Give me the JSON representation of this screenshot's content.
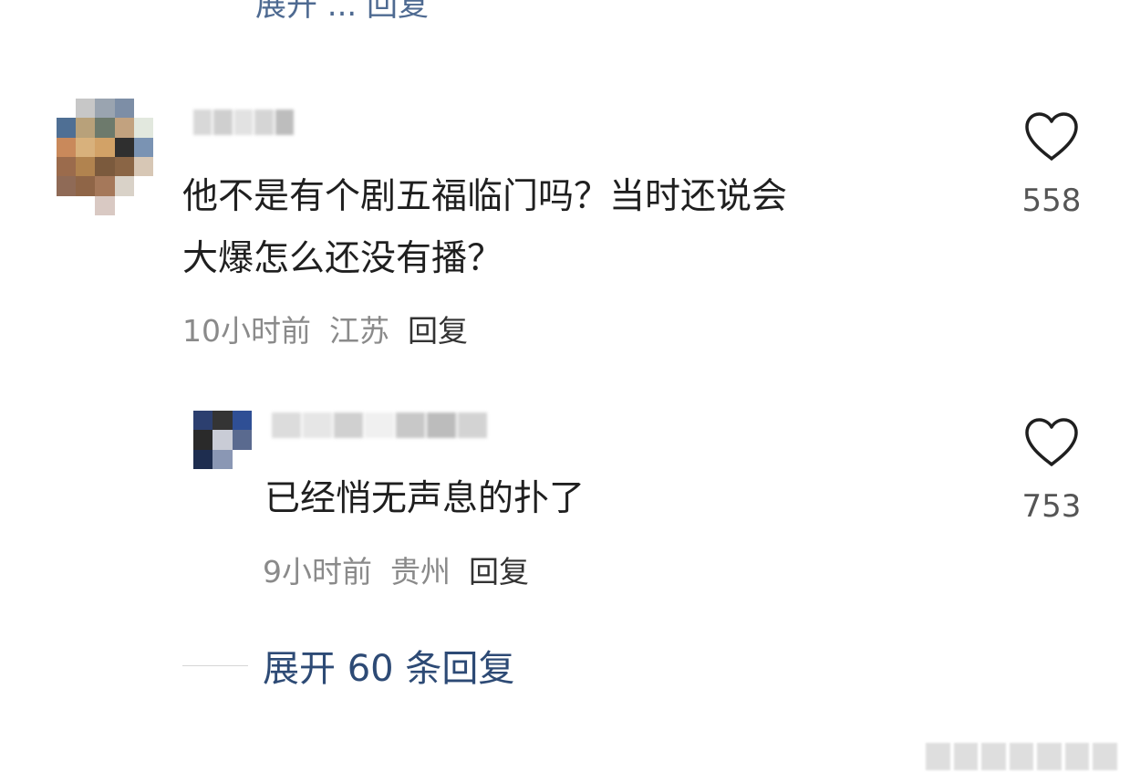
{
  "top_partial_text": "展开 ... 回复",
  "comments": [
    {
      "avatar_pixels": [
        "#ffffff",
        "#c7c7c7",
        "#9aa4b0",
        "#7d8ea6",
        "#ffffff",
        "#4f6f94",
        "#b8a17a",
        "#6d7a6c",
        "#c2a27f",
        "#e2e8de",
        "#c9895b",
        "#d8b17c",
        "#d2a267",
        "#2f2f2f",
        "#7a93b3",
        "#9b6b4c",
        "#b1834f",
        "#7b5a3d",
        "#8a6545",
        "#d7c7b5",
        "#8f6a56",
        "#8f6547",
        "#a5785a",
        "#d9d2c8",
        "#ffffff",
        "#ffffff",
        "#ffffff",
        "#d9c9c3",
        "#ffffff",
        "#ffffff"
      ],
      "username_blocks": [
        "#d8d8d8",
        "#cfcfcf",
        "#e2e2e2",
        "#d5d5d5",
        "#bdbdbd"
      ],
      "text": "他不是有个剧五福临门吗？当时还说会\n大爆怎么还没有播？",
      "time": "10小时前",
      "location": "江苏",
      "reply_label": "回复",
      "likes": "558"
    },
    {
      "avatar_pixels": [
        "#2c3f6f",
        "#343434",
        "#2f4f95",
        "#2a2a2a",
        "#c9ccd6",
        "#5a6a8f",
        "#1e2d4f",
        "#8a97b4",
        "#ffffff"
      ],
      "username_blocks": [
        "#dcdcdc",
        "#e6e6e6",
        "#d0d0d0",
        "#f0f0f0",
        "#c8c8c8",
        "#bcbcbc",
        "#d3d3d3"
      ],
      "text": "已经悄无声息的扑了",
      "time": "9小时前",
      "location": "贵州",
      "reply_label": "回复",
      "likes": "753"
    }
  ],
  "expand_replies": "展开 60 条回复",
  "colors": {
    "link_blue": "#2d4a75",
    "meta_gray": "#8a8a8a",
    "heart_stroke": "#1f1f1f"
  },
  "icons": {
    "like": "heart-outline-icon"
  }
}
